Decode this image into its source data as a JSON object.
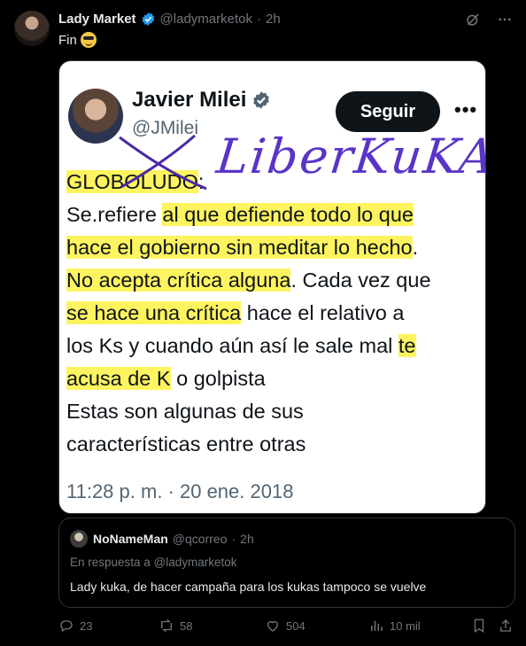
{
  "author": {
    "display_name": "Lady Market",
    "handle": "@ladymarketok",
    "separator": "·",
    "time": "2h"
  },
  "tweet": {
    "text": "Fin",
    "emoji": "sunglasses-emoji"
  },
  "media": {
    "name": "Javier Milei",
    "handle": "@JMilei",
    "follow_label": "Seguir",
    "more": "•••",
    "handwriting": "LiberKuKA",
    "lines": [
      [
        {
          "t": "GLOBOLUDO",
          "h": true
        },
        {
          "t": ":",
          "h": false
        }
      ],
      [
        {
          "t": "Se.refiere ",
          "h": false
        },
        {
          "t": "al que defiende todo lo que",
          "h": true
        }
      ],
      [
        {
          "t": "hace el gobierno sin meditar lo hecho",
          "h": true
        },
        {
          "t": ".",
          "h": false
        }
      ],
      [
        {
          "t": "No acepta crítica alguna",
          "h": true
        },
        {
          "t": ". Cada vez que",
          "h": false
        }
      ],
      [
        {
          "t": "se hace una crítica",
          "h": true
        },
        {
          "t": " hace el relativo a",
          "h": false
        }
      ],
      [
        {
          "t": "los Ks y cuando aún así le sale mal ",
          "h": false
        },
        {
          "t": "te",
          "h": true
        }
      ],
      [
        {
          "t": "acusa de K",
          "h": true
        },
        {
          "t": " o golpista",
          "h": false
        }
      ],
      [
        {
          "t": "Estas son algunas de sus",
          "h": false
        }
      ],
      [
        {
          "t": "características entre otras",
          "h": false
        }
      ]
    ],
    "timestamp": "11:28 p. m. · 20 ene. 2018"
  },
  "reply": {
    "name": "NoNameMan",
    "handle": "@qcorreo",
    "separator": "·",
    "time": "2h",
    "in_reply_to": "En respuesta a @ladymarketok",
    "text": "Lady kuka, de hacer campaña para los kukas tampoco se vuelve"
  },
  "actions": {
    "replies": "23",
    "reposts": "58",
    "likes": "504",
    "views": "10 mil"
  },
  "colors": {
    "background": "#000000",
    "muted": "#71767b",
    "verified": "#1d9bf0",
    "highlight": "#fdf45f",
    "handwriting": "#5a34c8"
  }
}
